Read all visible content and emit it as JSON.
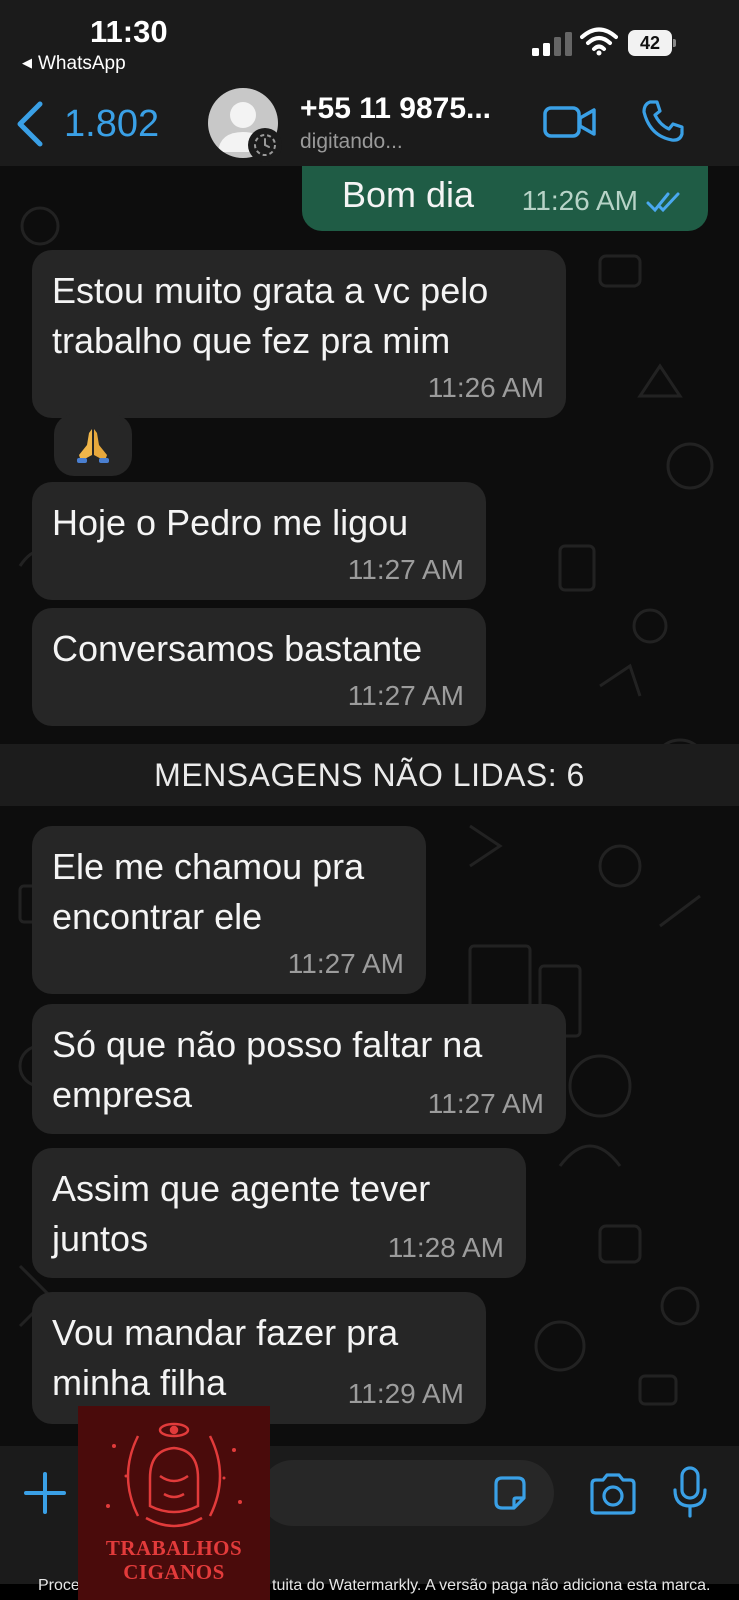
{
  "status_bar": {
    "time": "11:30",
    "back_app": "WhatsApp",
    "battery": "42"
  },
  "header": {
    "back_count": "1.802",
    "contact_name": "+55 11 9875...",
    "contact_status": "digitando...",
    "icons": [
      "chevron-left-icon",
      "avatar-icon",
      "video-call-icon",
      "phone-icon"
    ],
    "accent_color": "#3aa0e6"
  },
  "chat": {
    "incoming_bubble_color": "#262626",
    "outgoing_bubble_color": "#1f5c45",
    "messages": [
      {
        "direction": "out",
        "text": "Bom dia",
        "time": "11:26 AM",
        "read": true
      },
      {
        "direction": "in",
        "text": "Estou muito grata a vc pelo trabalho que fez pra mim",
        "time": "11:26 AM"
      },
      {
        "direction": "in",
        "text": "🙏",
        "time": ""
      },
      {
        "direction": "in",
        "text": "Hoje o Pedro me ligou",
        "time": "11:27 AM"
      },
      {
        "direction": "in",
        "text": "Conversamos bastante",
        "time": "11:27 AM"
      },
      {
        "direction": "in",
        "text": "Ele me chamou pra encontrar ele",
        "time": "11:27 AM"
      },
      {
        "direction": "in",
        "text": "Só que não posso faltar na empresa",
        "time": "11:27 AM"
      },
      {
        "direction": "in",
        "text": "Assim que agente tever juntos",
        "time": "11:28 AM"
      },
      {
        "direction": "in",
        "text": "Vou mandar fazer pra minha filha",
        "time": "11:29 AM"
      }
    ],
    "unread_label": "MENSAGENS NÃO LIDAS: 6"
  },
  "composer": {
    "icons": [
      "plus-icon",
      "sticker-icon",
      "camera-icon",
      "microphone-icon"
    ]
  },
  "watermark": {
    "text_left": "Proce",
    "text_right": "tuita do Watermarkly. A versão paga não adiciona esta marca.",
    "logo_line1": "TRABALHOS",
    "logo_line2": "CIGANOS"
  }
}
